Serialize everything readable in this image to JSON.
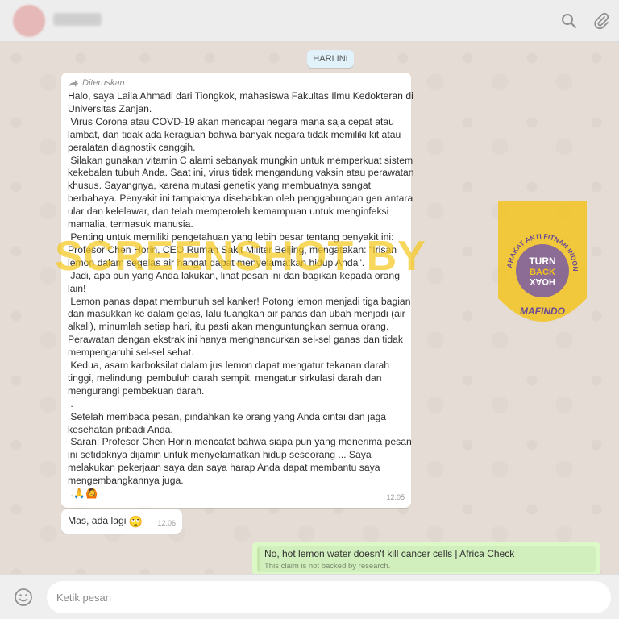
{
  "header": {
    "contact_name": "",
    "icons": [
      "search-icon",
      "attach-icon"
    ]
  },
  "chat": {
    "date_badge": "HARI INI",
    "forwarded_message": {
      "forwarded_label": "Diteruskan",
      "lines": [
        "Halo, saya Laila Ahmadi dari Tiongkok, mahasiswa Fakultas Ilmu Kedokteran di",
        "Universitas Zanjan.",
        " Virus Corona atau COVD-19 akan mencapai negara mana saja cepat atau",
        "lambat, dan tidak ada keraguan bahwa banyak negara tidak memiliki kit atau",
        "peralatan diagnostik canggih.",
        " Silakan gunakan vitamin C alami sebanyak mungkin untuk memperkuat sistem",
        "kekebalan tubuh Anda. Saat ini, virus tidak mengandung vaksin atau perawatan",
        "khusus. Sayangnya, karena mutasi genetik yang membuatnya sangat",
        "berbahaya. Penyakit ini tampaknya disebabkan oleh penggabungan gen antara",
        "ular dan kelelawar, dan telah memperoleh kemampuan untuk menginfeksi",
        "mamalia, termasuk manusia.",
        " Penting untuk memiliki pengetahuan yang lebih besar tentang penyakit ini:",
        "Profesor Chen Horin, CEO Rumah Sakit Militer Beijing, mengatakan: \"Irisan",
        "lemon dalam segelas air hangat dapat menyelamatkan hidup Anda\".",
        " Jadi, apa pun yang Anda lakukan, lihat pesan ini dan bagikan kepada orang",
        "lain!",
        " Lemon panas dapat membunuh sel kanker! Potong lemon menjadi tiga bagian",
        "dan masukkan ke dalam gelas, lalu tuangkan air panas dan ubah menjadi (air",
        "alkali), minumlah setiap hari, itu pasti akan menguntungkan semua orang.",
        "Perawatan dengan ekstrak ini hanya menghancurkan sel-sel ganas dan tidak",
        "mempengaruhi sel-sel sehat.",
        " Kedua, asam karboksilat dalam jus lemon dapat mengatur tekanan darah",
        "tinggi, melindungi pembuluh darah sempit, mengatur sirkulasi darah dan",
        "mengurangi pembekuan darah.",
        " .",
        " Setelah membaca pesan, pindahkan ke orang yang Anda cintai dan jaga",
        "kesehatan pribadi Anda.",
        " Saran: Profesor Chen Horin mencatat bahwa siapa pun yang menerima pesan",
        "ini setidaknya dijamin untuk menyelamatkan hidup seseorang ... Saya",
        "melakukan pekerjaan saya dan saya harap Anda dapat membantu saya",
        "mengembangkannya juga.",
        " .🙏🙆"
      ],
      "time": "12.05"
    },
    "second_message": {
      "text": "Mas, ada lagi",
      "emoji": "🙄",
      "time": "12.06"
    },
    "outgoing_link": {
      "title": "No, hot lemon water doesn't kill cancer cells | Africa Check",
      "description": "This claim is not backed by research."
    }
  },
  "watermark": {
    "text": "SCREENSHOT BY",
    "badge_ring_text": "MASYARAKAT ANTI FITNAH INDONESIA",
    "badge_bottom": "MAFINDO",
    "badge_center": [
      "TURN",
      "BACK",
      "HOAX"
    ],
    "color": "#f5c81e"
  },
  "footer": {
    "input_placeholder": "Ketik pesan"
  }
}
